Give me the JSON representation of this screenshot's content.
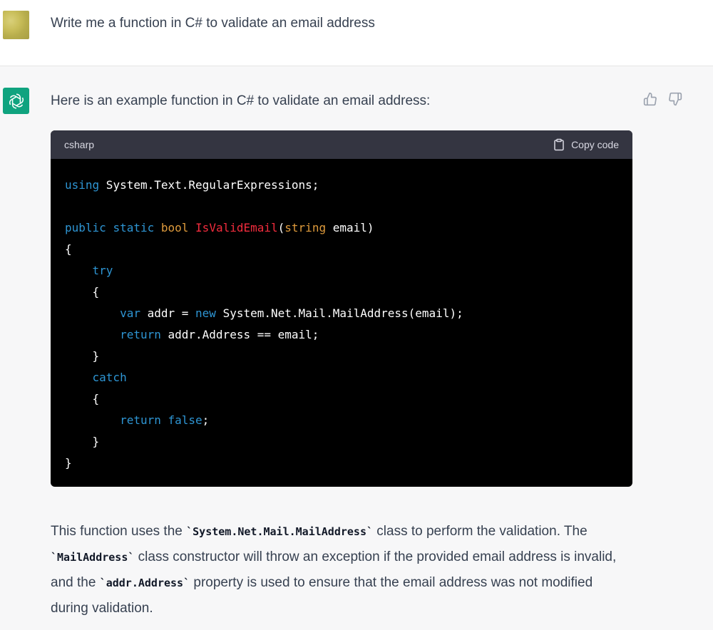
{
  "user": {
    "message": "Write me a function in C# to validate an email address"
  },
  "assistant": {
    "intro": "Here is an example function in C# to validate an email address:",
    "code": {
      "language": "csharp",
      "copy_label": "Copy code",
      "lines": [
        [
          {
            "t": "using",
            "c": "kw"
          },
          {
            "t": " System.Text.RegularExpressions;",
            "c": "plain"
          }
        ],
        [],
        [
          {
            "t": "public",
            "c": "kw"
          },
          {
            "t": " ",
            "c": "plain"
          },
          {
            "t": "static",
            "c": "kw"
          },
          {
            "t": " ",
            "c": "plain"
          },
          {
            "t": "bool",
            "c": "type"
          },
          {
            "t": " ",
            "c": "plain"
          },
          {
            "t": "IsValidEmail",
            "c": "fn"
          },
          {
            "t": "(",
            "c": "plain"
          },
          {
            "t": "string",
            "c": "type"
          },
          {
            "t": " email)",
            "c": "plain"
          }
        ],
        [
          {
            "t": "{",
            "c": "plain"
          }
        ],
        [
          {
            "t": "    ",
            "c": "plain"
          },
          {
            "t": "try",
            "c": "kw"
          }
        ],
        [
          {
            "t": "    {",
            "c": "plain"
          }
        ],
        [
          {
            "t": "        ",
            "c": "plain"
          },
          {
            "t": "var",
            "c": "kw"
          },
          {
            "t": " addr = ",
            "c": "plain"
          },
          {
            "t": "new",
            "c": "kw"
          },
          {
            "t": " System.Net.Mail.MailAddress(email);",
            "c": "plain"
          }
        ],
        [
          {
            "t": "        ",
            "c": "plain"
          },
          {
            "t": "return",
            "c": "kw"
          },
          {
            "t": " addr.Address == email;",
            "c": "plain"
          }
        ],
        [
          {
            "t": "    }",
            "c": "plain"
          }
        ],
        [
          {
            "t": "    ",
            "c": "plain"
          },
          {
            "t": "catch",
            "c": "kw"
          }
        ],
        [
          {
            "t": "    {",
            "c": "plain"
          }
        ],
        [
          {
            "t": "        ",
            "c": "plain"
          },
          {
            "t": "return",
            "c": "kw"
          },
          {
            "t": " ",
            "c": "plain"
          },
          {
            "t": "false",
            "c": "kw"
          },
          {
            "t": ";",
            "c": "plain"
          }
        ],
        [
          {
            "t": "    }",
            "c": "plain"
          }
        ],
        [
          {
            "t": "}",
            "c": "plain"
          }
        ]
      ]
    },
    "explanation": [
      {
        "t": "This function uses the ",
        "code": false
      },
      {
        "t": "`System.Net.Mail.MailAddress`",
        "code": true
      },
      {
        "t": " class to perform the validation. The ",
        "code": false
      },
      {
        "t": "`MailAddress`",
        "code": true
      },
      {
        "t": " class constructor will throw an exception if the provided email address is invalid, and the ",
        "code": false
      },
      {
        "t": "`addr.Address`",
        "code": true
      },
      {
        "t": " property is used to ensure that the email address was not modified during validation.",
        "code": false
      }
    ]
  },
  "colors": {
    "accent": "#10a37f",
    "keyword": "#2e95d3",
    "type": "#df9b3c",
    "function": "#f22c3d",
    "code_background": "#000000",
    "code_header": "#343541"
  },
  "icons": [
    "openai-logo-icon",
    "thumbs-up-icon",
    "thumbs-down-icon",
    "clipboard-icon"
  ]
}
